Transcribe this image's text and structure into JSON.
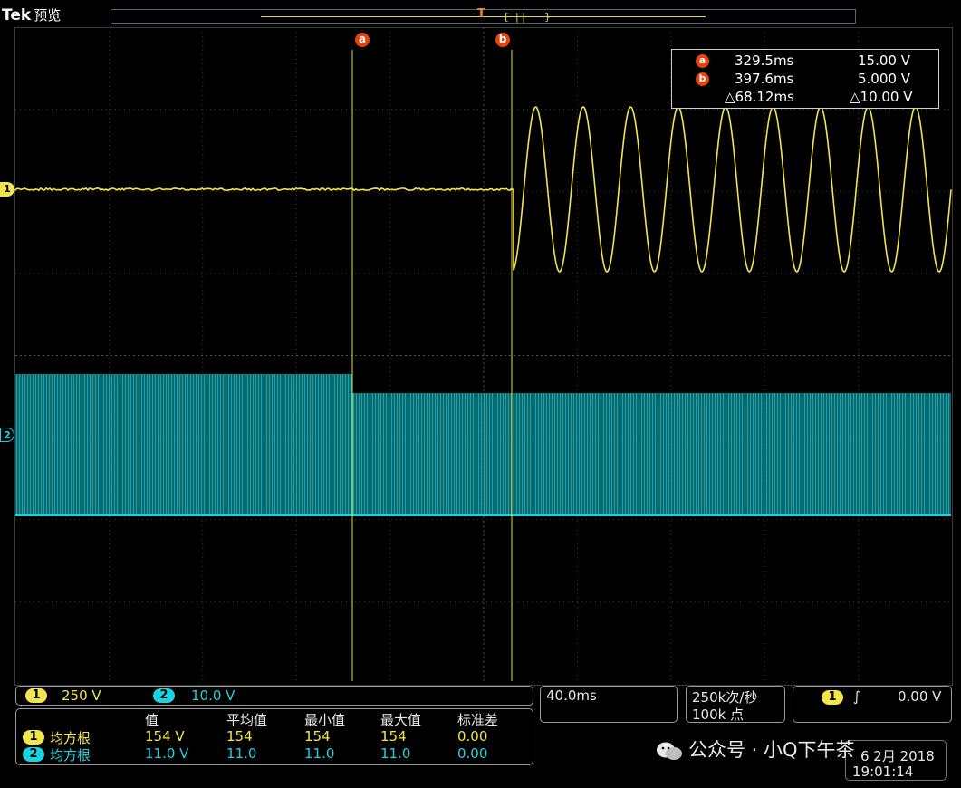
{
  "header": {
    "brand": "Tek",
    "mode": "预览"
  },
  "cursors": {
    "a_badge": "a",
    "b_badge": "b"
  },
  "readout": {
    "a_time": "329.5ms",
    "a_volt": "15.00 V",
    "b_time": "397.6ms",
    "b_volt": "5.000 V",
    "delta_time": "△68.12ms",
    "delta_volt": "△10.00 V"
  },
  "channels": {
    "ch1": {
      "label": "1",
      "scale": "250 V",
      "color": "#f2e64c"
    },
    "ch2": {
      "label": "2",
      "scale": "10.0 V",
      "color": "#19d4e0"
    }
  },
  "measurements": {
    "headers": [
      "值",
      "平均值",
      "最小值",
      "最大值",
      "标准差"
    ],
    "rows": [
      {
        "ch": "1",
        "name": "均方根",
        "values": [
          "154 V",
          "154",
          "154",
          "154",
          "0.00"
        ]
      },
      {
        "ch": "2",
        "name": "均方根",
        "values": [
          "11.0 V",
          "11.0",
          "11.0",
          "11.0",
          "0.00"
        ]
      }
    ]
  },
  "timebase": "40.0ms",
  "acquisition": {
    "rate": "250k次/秒",
    "points": "100k 点"
  },
  "trigger": {
    "source": "1",
    "slope": "∫",
    "level": "0.00 V"
  },
  "datetime": {
    "date": "6 2月 2018",
    "time": "19:01:14"
  },
  "watermark": "公众号 · 小Q下午茶"
}
